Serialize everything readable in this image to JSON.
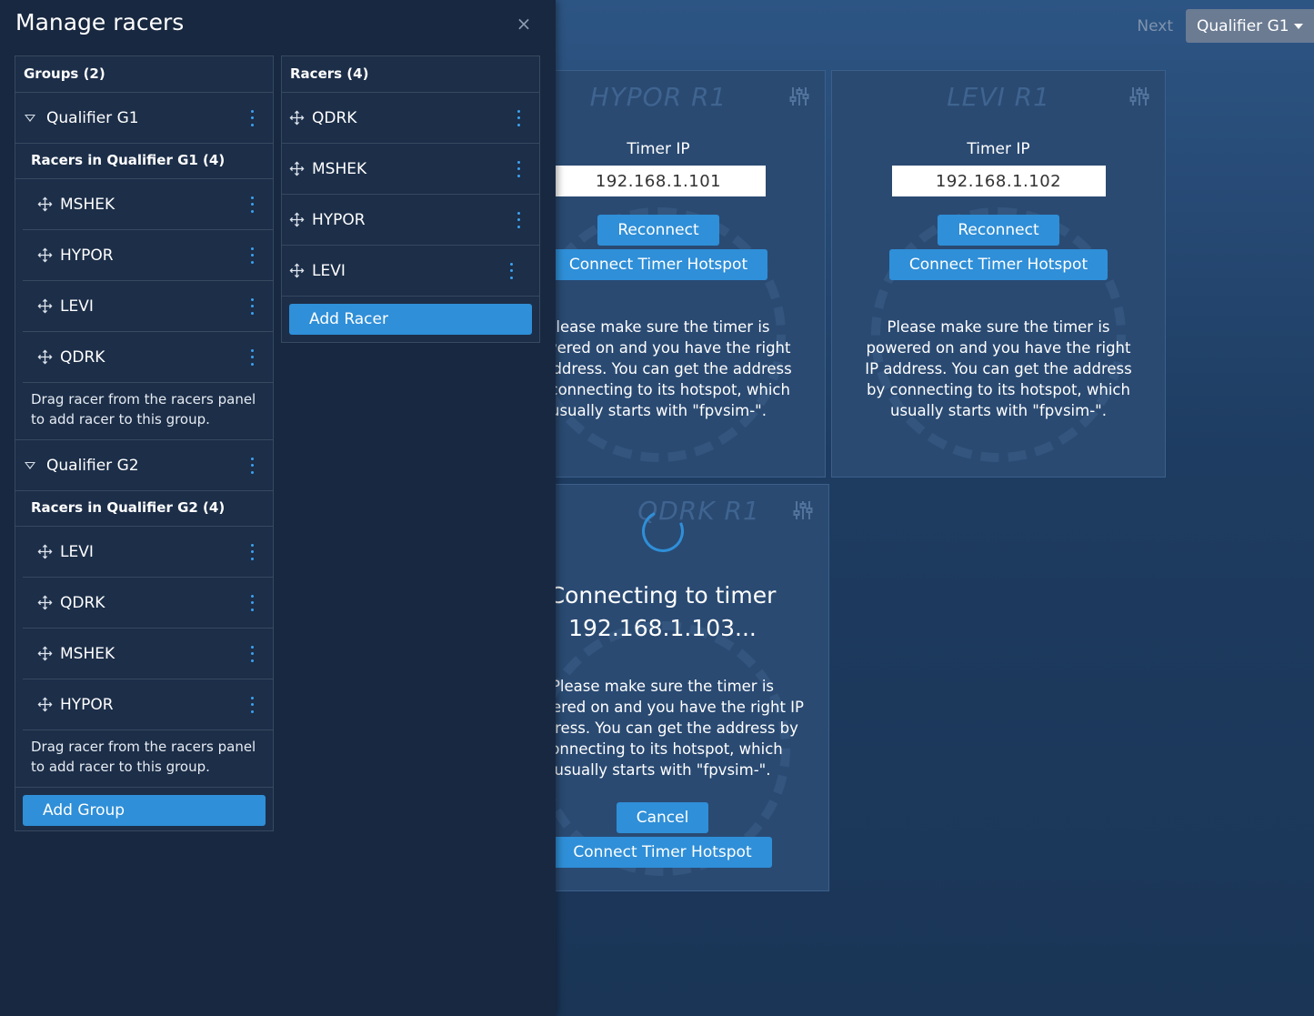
{
  "header": {
    "next_label": "Next",
    "group_select": "Qualifier G1"
  },
  "cards": [
    {
      "title": "HYPOR R1",
      "timer_ip_label": "Timer IP",
      "ip_value": "192.168.1.101",
      "reconnect_label": "Reconnect",
      "hotspot_label": "Connect Timer Hotspot",
      "help": "Please make sure the timer is powered on and you have the right IP address. You can get the address by connecting to its hotspot, which usually starts with \"fpvsim-\"."
    },
    {
      "title": "LEVI R1",
      "timer_ip_label": "Timer IP",
      "ip_value": "192.168.1.102",
      "reconnect_label": "Reconnect",
      "hotspot_label": "Connect Timer Hotspot",
      "help": "Please make sure the timer is powered on and you have the right IP address. You can get the address by connecting to its hotspot, which usually starts with \"fpvsim-\"."
    },
    {
      "title": "QDRK R1",
      "connecting_line1": "Connecting to timer",
      "connecting_line2": "192.168.1.103...",
      "help": "Please make sure the timer is powered on and you have the right IP address. You can get the address by connecting to its hotspot, which usually starts with \"fpvsim-\".",
      "cancel_label": "Cancel",
      "hotspot_label": "Connect Timer Hotspot"
    }
  ],
  "panel": {
    "title": "Manage racers",
    "close": "×",
    "groups_header": "Groups (2)",
    "racers_header": "Racers (4)",
    "groups": [
      {
        "name": "Qualifier G1",
        "subhead": "Racers in Qualifier G1 (4)",
        "racers": [
          "MSHEK",
          "HYPOR",
          "LEVI",
          "QDRK"
        ],
        "hint_line1": "Drag racer from the racers panel",
        "hint_line2": "to add racer to this group."
      },
      {
        "name": "Qualifier G2",
        "subhead": "Racers in Qualifier G2 (4)",
        "racers": [
          "LEVI",
          "QDRK",
          "MSHEK",
          "HYPOR"
        ],
        "hint_line1": "Drag racer from the racers panel",
        "hint_line2": "to add racer to this group."
      }
    ],
    "racers": [
      "QDRK",
      "MSHEK",
      "HYPOR",
      "LEVI"
    ],
    "add_racer_label": "Add Racer",
    "add_group_label": "Add Group"
  },
  "colors": {
    "accent": "#2f8fd8",
    "panel_bg": "#182840",
    "card_bg": "#2a4a72"
  }
}
